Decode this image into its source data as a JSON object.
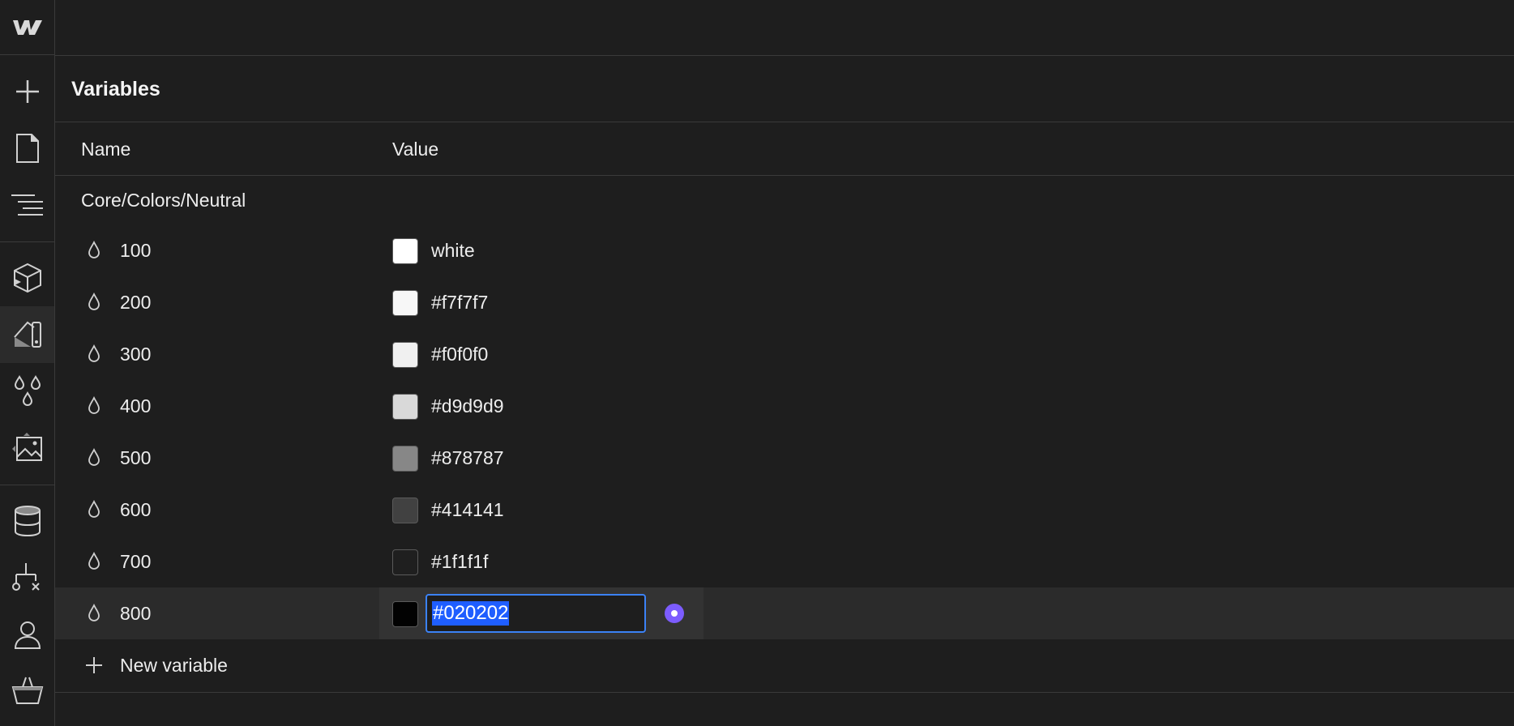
{
  "app": {
    "logo_icon": "webflow-logo-icon"
  },
  "rail": {
    "tools": [
      {
        "name": "add-icon"
      },
      {
        "name": "pages-icon"
      },
      {
        "name": "navigator-icon"
      },
      {
        "name": "components-icon"
      },
      {
        "name": "style-selector-icon"
      },
      {
        "name": "variables-icon"
      },
      {
        "name": "assets-icon"
      },
      {
        "name": "cms-icon"
      },
      {
        "name": "logic-icon"
      },
      {
        "name": "users-icon"
      },
      {
        "name": "ecommerce-icon"
      }
    ]
  },
  "panel": {
    "title": "Variables",
    "columns": {
      "name": "Name",
      "value": "Value"
    },
    "group": "Core/Colors/Neutral",
    "rows": [
      {
        "name": "100",
        "value": "white",
        "color": "#ffffff"
      },
      {
        "name": "200",
        "value": "#f7f7f7",
        "color": "#f7f7f7"
      },
      {
        "name": "300",
        "value": "#f0f0f0",
        "color": "#f0f0f0"
      },
      {
        "name": "400",
        "value": "#d9d9d9",
        "color": "#d9d9d9"
      },
      {
        "name": "500",
        "value": "#878787",
        "color": "#878787"
      },
      {
        "name": "600",
        "value": "#414141",
        "color": "#414141"
      },
      {
        "name": "700",
        "value": "#1f1f1f",
        "color": "#1f1f1f"
      }
    ],
    "editing_row": {
      "name": "800",
      "value": "#020202",
      "color": "#020202"
    },
    "new_variable_label": "New variable"
  },
  "colors": {
    "background": "#1e1e1e",
    "selected_row": "#2b2b2b",
    "focus_border": "#3b82f6",
    "text_selection": "#1f5eff",
    "bind_accent": "#7c5cff"
  }
}
